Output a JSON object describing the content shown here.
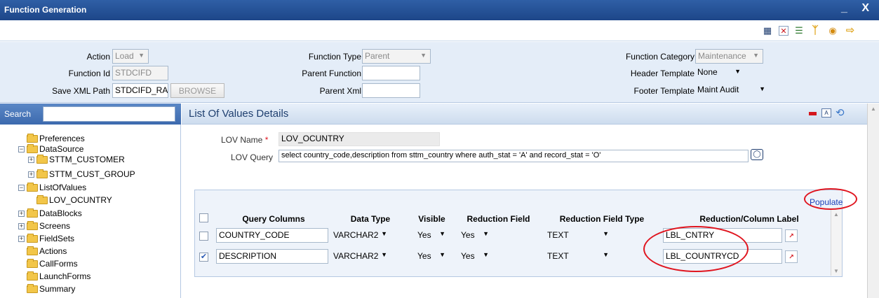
{
  "window": {
    "title": "Function Generation",
    "controls": "_ X"
  },
  "toolbar": {
    "icons": [
      "save-icon",
      "close-icon",
      "list-icon",
      "generate-icon",
      "deploy-icon",
      "exit-icon"
    ]
  },
  "header": {
    "action_label": "Action",
    "action_value": "Load",
    "function_id_label": "Function Id",
    "function_id_value": "STDCIFD",
    "save_xml_label": "Save XML Path",
    "save_xml_value": "STDCIFD_RAI",
    "browse_label": "BROWSE",
    "function_type_label": "Function Type",
    "function_type_value": "Parent",
    "parent_function_label": "Parent Function",
    "parent_function_value": "",
    "parent_xml_label": "Parent Xml",
    "parent_xml_value": "",
    "function_category_label": "Function Category",
    "function_category_value": "Maintenance",
    "header_template_label": "Header Template",
    "header_template_value": "None",
    "footer_template_label": "Footer Template",
    "footer_template_value": "Maint Audit"
  },
  "sidebar": {
    "search_label": "Search",
    "tree": [
      {
        "label": "Preferences",
        "toggle": ""
      },
      {
        "label": "DataSource",
        "toggle": "−"
      },
      {
        "label": "STTM_CUSTOMER",
        "toggle": "+"
      },
      {
        "label": "STTM_CUST_GROUP",
        "toggle": "+"
      },
      {
        "label": "ListOfValues",
        "toggle": "−"
      },
      {
        "label": "LOV_OCUNTRY",
        "toggle": ""
      },
      {
        "label": "DataBlocks",
        "toggle": "+"
      },
      {
        "label": "Screens",
        "toggle": "+"
      },
      {
        "label": "FieldSets",
        "toggle": "+"
      },
      {
        "label": "Actions",
        "toggle": ""
      },
      {
        "label": "CallForms",
        "toggle": ""
      },
      {
        "label": "LaunchForms",
        "toggle": ""
      },
      {
        "label": "Summary",
        "toggle": ""
      }
    ]
  },
  "main": {
    "title": "List Of Values Details",
    "lov_name_label": "LOV Name",
    "required_mark": "*",
    "lov_name_value": "LOV_OCUNTRY",
    "lov_query_label": "LOV Query",
    "lov_query_value": "select country_code,description from sttm_country where auth_stat = 'A' and record_stat = 'O'",
    "populate_label": "Populate",
    "columns": [
      "Query Columns",
      "Data Type",
      "Visible",
      "Reduction Field",
      "Reduction Field Type",
      "Reduction/Column Label"
    ],
    "rows": [
      {
        "checked": false,
        "query_column": "COUNTRY_CODE",
        "data_type": "VARCHAR2",
        "visible": "Yes",
        "reduction_field": "Yes",
        "reduction_field_type": "TEXT",
        "label": "LBL_CNTRY"
      },
      {
        "checked": true,
        "query_column": "DESCRIPTION",
        "data_type": "VARCHAR2",
        "visible": "Yes",
        "reduction_field": "Yes",
        "reduction_field_type": "TEXT",
        "label": "LBL_COUNTRYCD"
      }
    ]
  },
  "colors": {
    "title_bar": "#1d4689",
    "header_bg": "#e4edf8",
    "highlight": "#e0151f",
    "link": "#1a3fb8"
  }
}
